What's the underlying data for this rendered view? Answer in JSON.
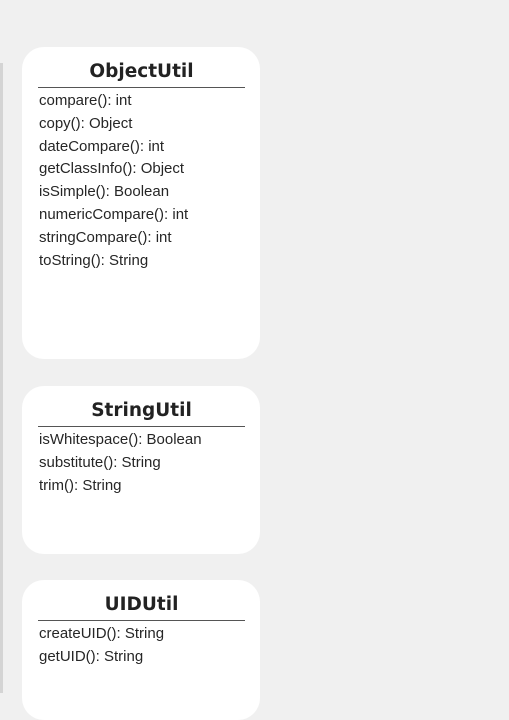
{
  "classes": [
    {
      "name": "ObjectUtil",
      "methods": [
        "compare(): int",
        "copy(): Object",
        "dateCompare(): int",
        "getClassInfo(): Object",
        "isSimple(): Boolean",
        "numericCompare(): int",
        "stringCompare(): int",
        "toString(): String"
      ]
    },
    {
      "name": "StringUtil",
      "methods": [
        "isWhitespace(): Boolean",
        "substitute(): String",
        "trim(): String"
      ]
    },
    {
      "name": "UIDUtil",
      "methods": [
        "createUID(): String",
        "getUID(): String"
      ]
    }
  ]
}
